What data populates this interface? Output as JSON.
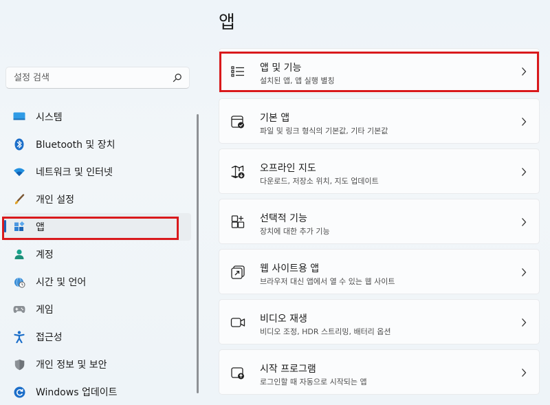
{
  "page_title": "앱",
  "search": {
    "placeholder": "설정 검색"
  },
  "sidebar": {
    "items": [
      {
        "label": "시스템",
        "icon": "monitor-icon"
      },
      {
        "label": "Bluetooth 및 장치",
        "icon": "bluetooth-icon"
      },
      {
        "label": "네트워크 및 인터넷",
        "icon": "wifi-icon"
      },
      {
        "label": "개인 설정",
        "icon": "brush-icon"
      },
      {
        "label": "앱",
        "icon": "apps-icon",
        "active": true
      },
      {
        "label": "계정",
        "icon": "person-icon"
      },
      {
        "label": "시간 및 언어",
        "icon": "globe-clock-icon"
      },
      {
        "label": "게임",
        "icon": "gamepad-icon"
      },
      {
        "label": "접근성",
        "icon": "accessibility-icon"
      },
      {
        "label": "개인 정보 및 보안",
        "icon": "shield-icon"
      },
      {
        "label": "Windows 업데이트",
        "icon": "update-icon"
      }
    ]
  },
  "cards": [
    {
      "title": "앱 및 기능",
      "subtitle": "설치된 앱, 앱 실행 별칭",
      "icon": "list-icon"
    },
    {
      "title": "기본 앱",
      "subtitle": "파일 및 링크 형식의 기본값, 기타 기본값",
      "icon": "default-apps-icon"
    },
    {
      "title": "오프라인 지도",
      "subtitle": "다운로드, 저장소 위치, 지도 업데이트",
      "icon": "map-download-icon"
    },
    {
      "title": "선택적 기능",
      "subtitle": "장치에 대한 추가 기능",
      "icon": "add-grid-icon"
    },
    {
      "title": "웹 사이트용 앱",
      "subtitle": "브라우저 대신 앱에서 열 수 있는 웹 사이트",
      "icon": "link-window-icon"
    },
    {
      "title": "비디오 재생",
      "subtitle": "비디오 조정, HDR 스트리밍, 배터리 옵션",
      "icon": "video-icon"
    },
    {
      "title": "시작 프로그램",
      "subtitle": "로그인할 때 자동으로 시작되는 앱",
      "icon": "startup-icon"
    }
  ],
  "colors": {
    "accent": "#1c62b9",
    "highlight": "#d9191c"
  }
}
